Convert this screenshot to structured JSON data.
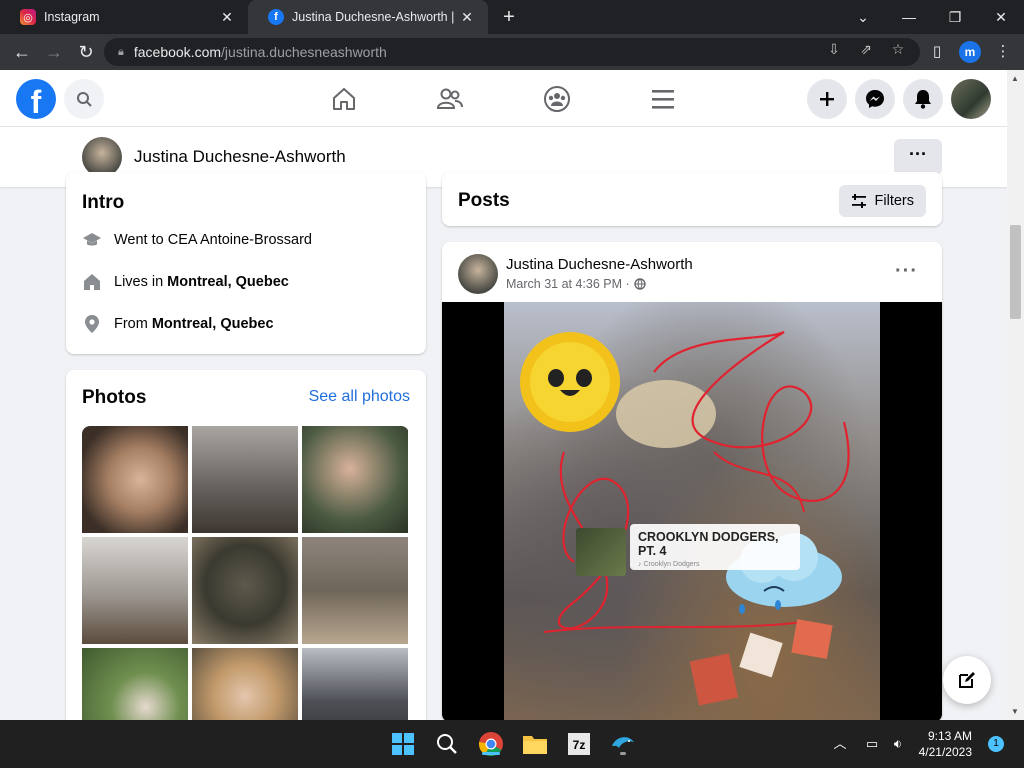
{
  "browser": {
    "tabs": [
      {
        "title": "Instagram",
        "icon": "instagram-icon"
      },
      {
        "title": "Justina Duchesne-Ashworth | Fac",
        "icon": "facebook-icon"
      }
    ],
    "url_host": "facebook.com",
    "url_path": "/justina.duchesneashworth",
    "profile_initial": "m"
  },
  "fb": {
    "logo_letter": "f"
  },
  "profile_bar": {
    "name": "Justina Duchesne-Ashworth",
    "more": "···"
  },
  "intro": {
    "title": "Intro",
    "items": [
      {
        "icon": "graduation-cap-icon",
        "prefix": "Went to CEA Antoine-Brossard",
        "bold": ""
      },
      {
        "icon": "home-icon",
        "prefix": "Lives in",
        "bold": "Montreal, Quebec"
      },
      {
        "icon": "location-pin-icon",
        "prefix": "From",
        "bold": "Montreal, Quebec"
      }
    ]
  },
  "photos": {
    "title": "Photos",
    "see_all": "See all photos"
  },
  "posts": {
    "title": "Posts",
    "filters": "Filters"
  },
  "post": {
    "author": "Justina Duchesne-Ashworth",
    "date": "March 31 at 4:36 PM ·",
    "sticker_title": "CROOKLYN DODGERS, PT. 4",
    "sticker_sub": "♪ Crooklyn Dodgers"
  },
  "taskbar": {
    "time": "9:13 AM",
    "date": "4/21/2023",
    "notifications": "1"
  },
  "colors": {
    "fb_blue": "#1877f2",
    "link_blue": "#216fdb",
    "chrome_dark": "#202124"
  }
}
